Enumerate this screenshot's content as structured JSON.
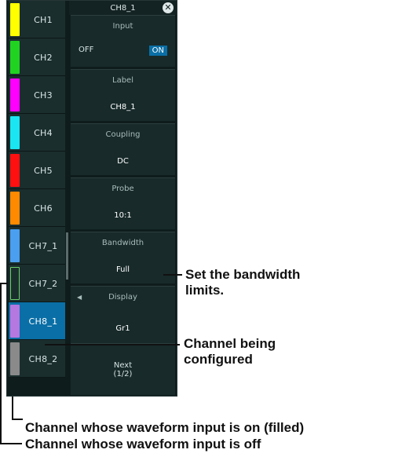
{
  "channels": [
    {
      "label": "CH1",
      "color": "#ffff00",
      "state": "on"
    },
    {
      "label": "CH2",
      "color": "#21d321",
      "state": "on"
    },
    {
      "label": "CH3",
      "color": "#ff00ff",
      "state": "on"
    },
    {
      "label": "CH4",
      "color": "#19e6f2",
      "state": "on"
    },
    {
      "label": "CH5",
      "color": "#ff1010",
      "state": "on"
    },
    {
      "label": "CH6",
      "color": "#ff8a00",
      "state": "on"
    },
    {
      "label": "CH7_1",
      "color": "#4a9ff0",
      "state": "on"
    },
    {
      "label": "CH7_2",
      "color": "#6bcf6b",
      "state": "off"
    },
    {
      "label": "CH8_1",
      "color": "#b478e0",
      "state": "selected"
    },
    {
      "label": "CH8_2",
      "color": "#8a8a8a",
      "state": "on"
    }
  ],
  "panel": {
    "title": "CH8_1",
    "input": {
      "label": "Input",
      "off": "OFF",
      "on": "ON"
    },
    "label_field": {
      "label": "Label",
      "value": "CH8_1"
    },
    "coupling": {
      "label": "Coupling",
      "value": "DC"
    },
    "probe": {
      "label": "Probe",
      "value": "10:1"
    },
    "bandwidth": {
      "label": "Bandwidth",
      "value": "Full"
    },
    "display": {
      "label": "Display",
      "value": "Gr1"
    },
    "next": {
      "line1": "Next",
      "line2": "(1/2)"
    }
  },
  "annotations": {
    "bandwidth": [
      "Set the bandwidth",
      "limits."
    ],
    "configured": [
      "Channel being",
      "configured"
    ],
    "input_on": "Channel whose waveform input is on (filled)",
    "input_off": "Channel whose waveform input is off"
  }
}
